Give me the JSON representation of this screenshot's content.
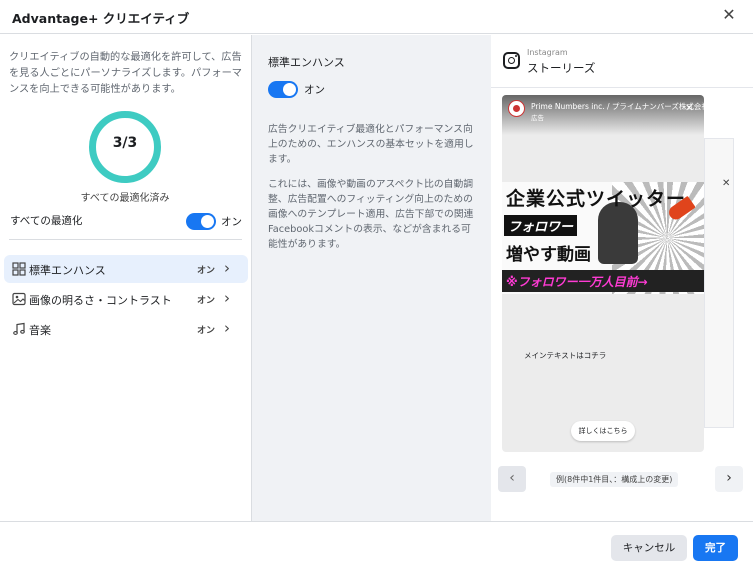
{
  "header": {
    "title": "Advantage+ クリエイティブ",
    "close_icon": "close-icon"
  },
  "left": {
    "description": "クリエイティブの自動的な最適化を許可して、広告を見る人ごとにパーソナライズします。パフォーマンスを向上できる可能性があります。",
    "progress_value": "3/3",
    "progress_fraction": 1.0,
    "progress_caption": "すべての最適化済み",
    "all_optimizations_label": "すべての最適化",
    "all_optimizations_state": "オン",
    "options": [
      {
        "label": "標準エンハンス",
        "state": "オン",
        "icon": "grid-icon",
        "active": true
      },
      {
        "label": "画像の明るさ・コントラスト",
        "state": "オン",
        "icon": "image-icon",
        "active": false
      },
      {
        "label": "音楽",
        "state": "オン",
        "icon": "music-note-icon",
        "active": false
      }
    ]
  },
  "middle": {
    "heading": "標準エンハンス",
    "toggle_state": "オン",
    "paragraph1": "広告クリエイティブ最適化とパフォーマンス向上のための、エンハンスの基本セットを適用します。",
    "paragraph2": "これには、画像や動画のアスペクト比の自動調整、広告配置へのフィッティング向上のための画像へのテンプレート適用、広告下部での関連Facebookコメントの表示、などが含まれる可能性があります。"
  },
  "preview": {
    "platform": "Instagram",
    "placement": "ストーリーズ",
    "advertiser": "Prime Numbers inc. / プライムナンバーズ株式会社",
    "ad_label": "広告",
    "creative_line1": "企業公式ツイッター",
    "creative_line2": "フォロワー",
    "creative_line3": "増やす動画",
    "creative_line4": "※フォロワー一万人目前→",
    "main_text": "メインテキストはコチラ",
    "cta": "詳しくはこちら",
    "pager_label": "例(8件中1件目、：構成上の変更)"
  },
  "footer": {
    "cancel": "キャンセル",
    "done": "完了"
  },
  "colors": {
    "accent": "#1877f2",
    "ring": "#3ecbc2",
    "active_row": "#e7f0fd"
  }
}
